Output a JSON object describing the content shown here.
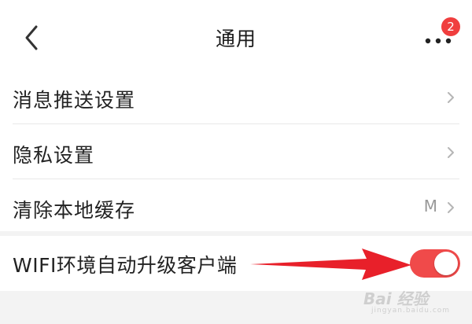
{
  "header": {
    "title": "通用",
    "back_icon": "chevron-left-icon",
    "more_icon": "more-dots-icon",
    "badge_count": "2"
  },
  "settings": {
    "items": [
      {
        "label": "消息推送设置",
        "icon": "chevron-right-icon"
      },
      {
        "label": "隐私设置",
        "icon": "chevron-right-icon"
      },
      {
        "label": "清除本地缓存",
        "value": "M",
        "icon": "chevron-right-icon"
      }
    ],
    "wifi_upgrade": {
      "label": "WIFI环境自动升级客户端",
      "enabled": true
    }
  },
  "watermark": {
    "text": "Bai 经验",
    "sub": "jingyan.baidu.com"
  },
  "colors": {
    "accent": "#f04a4a",
    "badge": "#f03e3e",
    "background": "#f3f3f3",
    "annotation_arrow": "#e8202a"
  }
}
